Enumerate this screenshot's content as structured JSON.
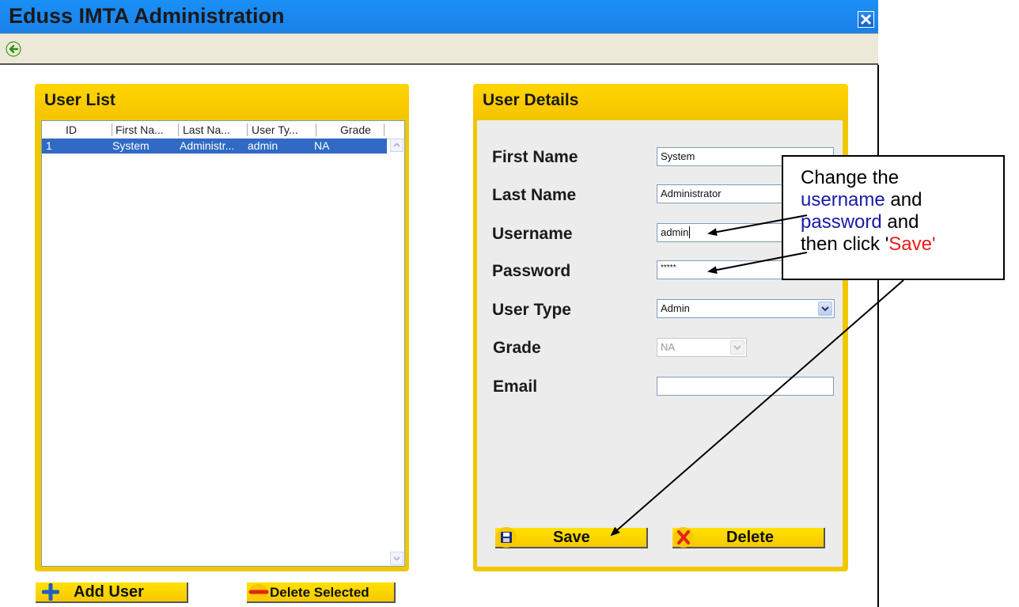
{
  "window": {
    "title": "Eduss IMTA Administration"
  },
  "user_list": {
    "title": "User List",
    "columns": [
      "ID",
      "First Na...",
      "Last Na...",
      "User Ty...",
      "Grade"
    ],
    "rows": [
      {
        "id": "1",
        "first": "System",
        "last": "Administr...",
        "type": "admin",
        "grade": "NA"
      }
    ],
    "add_label": "Add User",
    "delete_label": "Delete Selected"
  },
  "user_details": {
    "title": "User Details",
    "labels": {
      "first_name": "First Name",
      "last_name": "Last Name",
      "username": "Username",
      "password": "Password",
      "user_type": "User Type",
      "grade": "Grade",
      "email": "Email"
    },
    "values": {
      "first_name": "System",
      "last_name": "Administrator",
      "username": "admin",
      "password": "*****",
      "user_type": "Admin",
      "grade": "NA",
      "email": ""
    },
    "save_label": "Save",
    "delete_label": "Delete"
  },
  "callout": {
    "line1": "Change the",
    "username_word": "username",
    "and1": " and",
    "password_word": "password",
    "and2": " and",
    "then_click": "then click '",
    "save_word": "Save",
    "quote_end": "'"
  },
  "colors": {
    "title_bar": "#1b87ee",
    "panel": "#f6c400",
    "selection": "#316ac5",
    "callout_blue": "#1a1aa8",
    "callout_red": "#e81b1b"
  }
}
